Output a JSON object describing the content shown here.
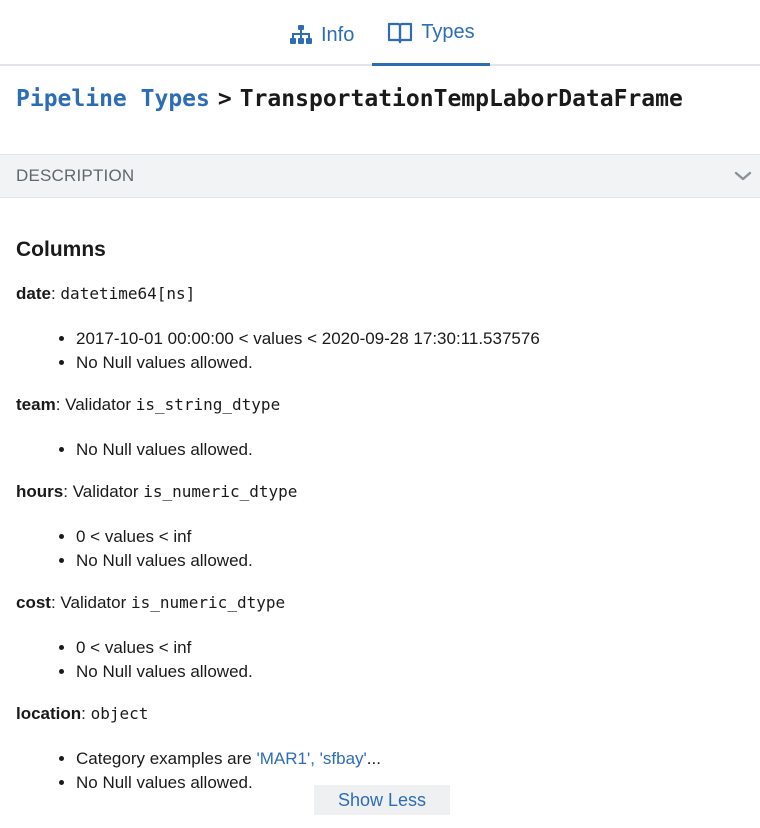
{
  "tabs": [
    {
      "label": "Info",
      "icon": "sitemap-icon",
      "active": false
    },
    {
      "label": "Types",
      "icon": "book-icon",
      "active": true
    }
  ],
  "breadcrumb": {
    "link": "Pipeline Types",
    "separator": ">",
    "current": "TransportationTempLaborDataFrame"
  },
  "description": {
    "label": "DESCRIPTION",
    "icon": "chevron-down-icon"
  },
  "columns_heading": "Columns",
  "columns": [
    {
      "name": "date",
      "sep": ": ",
      "prefix": "",
      "type": "datetime64[ns]",
      "items": [
        "2017-10-01 00:00:00 < values < 2020-09-28 17:30:11.537576",
        "No Null values allowed."
      ]
    },
    {
      "name": "team",
      "sep": ": ",
      "prefix": "Validator ",
      "type": "is_string_dtype",
      "items": [
        "No Null values allowed."
      ]
    },
    {
      "name": "hours",
      "sep": ": ",
      "prefix": "Validator ",
      "type": "is_numeric_dtype",
      "items": [
        "0 < values < inf",
        "No Null values allowed."
      ]
    },
    {
      "name": "cost",
      "sep": ": ",
      "prefix": "Validator ",
      "type": "is_numeric_dtype",
      "items": [
        "0 < values < inf",
        "No Null values allowed."
      ]
    },
    {
      "name": "location",
      "sep": ": ",
      "prefix": "",
      "type": "object",
      "category": {
        "before": "Category examples are ",
        "examples": "'MAR1', 'sfbay'",
        "after": "..."
      },
      "items": [
        "No Null values allowed."
      ]
    }
  ],
  "show_less_label": "Show Less",
  "colors": {
    "accent": "#2d6db5",
    "text": "#1a1a1a",
    "muted": "#5f6770",
    "bar": "#f1f3f5"
  }
}
